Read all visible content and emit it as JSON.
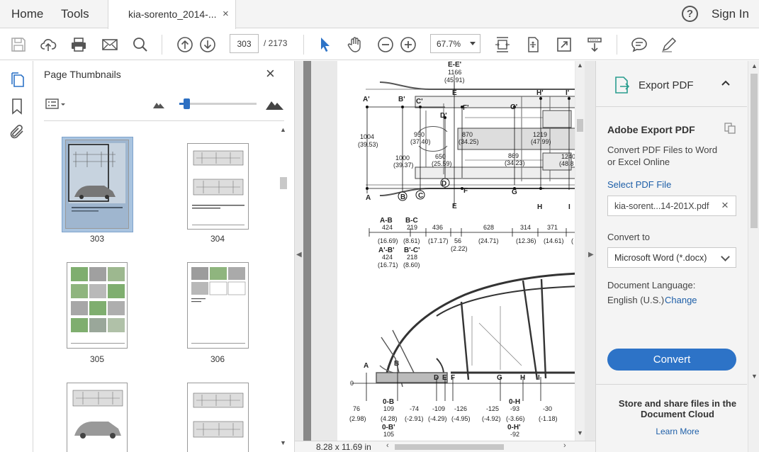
{
  "menubar": {
    "home": "Home",
    "tools": "Tools",
    "tab_title": "kia-sorento_2014-...",
    "tab_close": "×",
    "help": "?",
    "sign_in": "Sign In"
  },
  "toolbar": {
    "page_current": "303",
    "page_total": "/  2173",
    "zoom": "67.7%",
    "icons": [
      "save-icon",
      "upload-cloud-icon",
      "print-icon",
      "email-icon",
      "search-icon",
      "page-up-icon",
      "page-down-icon",
      "select-arrow-icon",
      "hand-icon",
      "zoom-out-icon",
      "zoom-in-icon",
      "fit-page-icon",
      "rotate-icon",
      "fullscreen-icon",
      "scroll-mode-icon",
      "comment-icon",
      "pen-icon"
    ]
  },
  "thumbnails": {
    "title": "Page Thumbnails",
    "close": "×",
    "zoom_level": 0.06,
    "pages": [
      "303",
      "304",
      "305",
      "306",
      "",
      ""
    ]
  },
  "document": {
    "dims": "8.28 x 11.69 in",
    "labels": {
      "ee": "E-E'",
      "ee_val": "1166",
      "ee_in": "(45.91)",
      "a_top": "A'",
      "b_top": "B'",
      "c_top": "C'",
      "d_top": "D'",
      "e_top": "E",
      "f_top": "F'",
      "g_top": "G'",
      "h_top": "H'",
      "i_top": "I'",
      "v1004": "1004",
      "v1004_in": "(39.53)",
      "v1000": "1000",
      "v1000_in": "(39.37)",
      "v950": "950",
      "v950_in": "(37.40)",
      "v870": "870",
      "v870_in": "(34.25)",
      "v650": "650",
      "v650_in": "(25.59)",
      "v869": "869",
      "v869_in": "(34.23)",
      "v1219": "1219",
      "v1219_in": "(47.99)",
      "v1240": "1240",
      "v1240_in": "(48.8",
      "a": "A",
      "b": "B",
      "c": "C",
      "d": "D",
      "e": "E",
      "f": "F",
      "g": "G",
      "h": "H",
      "i": "I",
      "ab": "A-B",
      "ab_v": "424",
      "ab_in": "(16.69)",
      "bc": "B-C",
      "bc_v": "219",
      "bc_in": "(8.61)",
      "d436": "436",
      "d436_in": "(17.17)",
      "d56": "56",
      "d56_in": "(2.22)",
      "d628": "628",
      "d628_in": "(24.71)",
      "d314": "314",
      "d314_in": "(12.36)",
      "d371": "371",
      "d371_in": "(14.61)",
      "d_trunc": "(",
      "apbp": "A'-B'",
      "apbp_v": "424",
      "apbp_in": "(16.71)",
      "bpcp": "B'-C'",
      "bpcp_v": "218",
      "bpcp_in": "(8.60)",
      "zero": "0",
      "s76": "76",
      "s76_in": "(2.98)",
      "s0b": "0-B",
      "s109": "109",
      "s109_in": "(4.28)",
      "s0bp": "0-B'",
      "s105": "105",
      "s74": "-74",
      "s74_in": "(-2.91)",
      "s109n": "-109",
      "s109n_in": "(-4.29)",
      "s126": "-126",
      "s126_in": "(-4.95)",
      "s125": "-125",
      "s125_in": "(-4.92)",
      "s0h": "0-H",
      "s93": "-93",
      "s93_in": "(-3.66)",
      "s0hp": "0-H'",
      "s92": "-92",
      "s30": "-30",
      "s30_in": "(-1.18)"
    }
  },
  "export": {
    "title": "Export PDF",
    "card_title": "Adobe Export PDF",
    "description": "Convert PDF Files to Word or Excel Online",
    "select_file": "Select PDF File",
    "file_name": "kia-sorent...14-201X.pdf",
    "file_clear": "×",
    "convert_to_label": "Convert to",
    "convert_to_value": "Microsoft Word (*.docx)",
    "language_label": "Document Language:",
    "language_value": "English (U.S.)",
    "language_change": "Change",
    "convert_button": "Convert",
    "store_text": "Store and share files in the Document Cloud",
    "learn_more": "Learn More"
  },
  "colors": {
    "accent": "#2d73c7",
    "link": "#1e5fa8",
    "panel_bg": "#f4f4f4",
    "selected_thumb": "#a9c4e0"
  }
}
